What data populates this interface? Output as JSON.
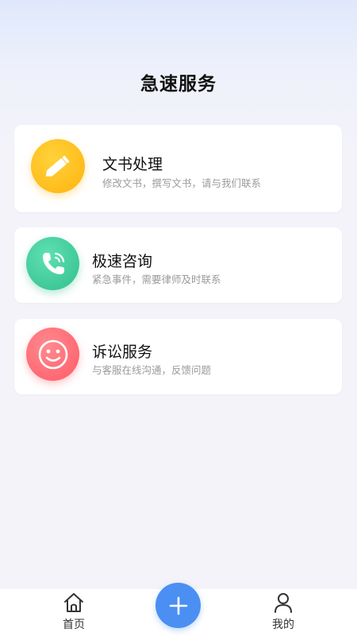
{
  "header": {
    "title": "急速服务"
  },
  "services": [
    {
      "title": "文书处理",
      "desc": "修改文书，撰写文书，请与我们联系",
      "icon": "pencil-icon",
      "color": "#ffc21a"
    },
    {
      "title": "极速咨询",
      "desc": "紧急事件，需要律师及时联系",
      "icon": "phone-icon",
      "color": "#3fcb9b"
    },
    {
      "title": "诉讼服务",
      "desc": "与客服在线沟通，反馈问题",
      "icon": "smile-icon",
      "color": "#ff6f78"
    }
  ],
  "tabbar": {
    "home_label": "首页",
    "add_icon": "plus-icon",
    "mine_label": "我的"
  }
}
